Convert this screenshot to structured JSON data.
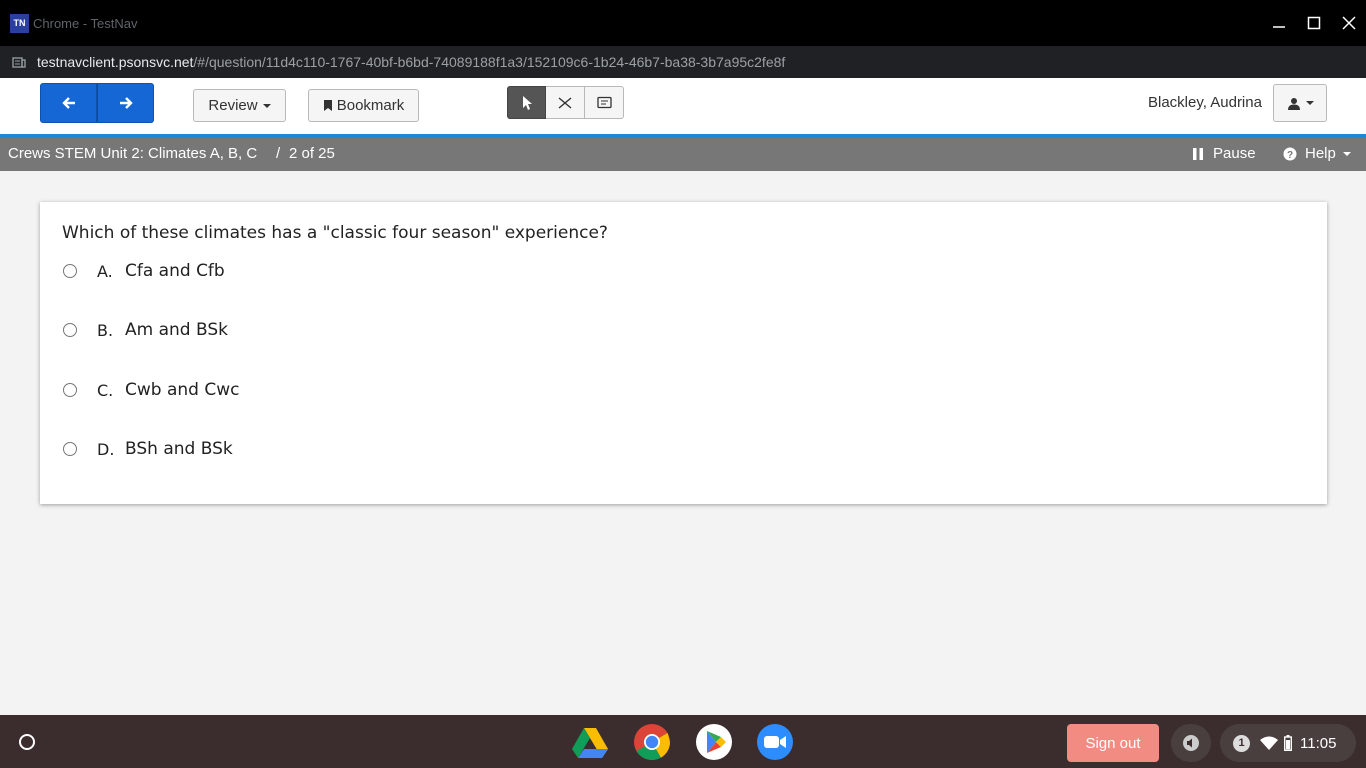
{
  "window": {
    "app_icon_text": "TN",
    "title": "Chrome - TestNav"
  },
  "url": {
    "host": "testnavclient.psonsvc.net",
    "path": "/#/question/11d4c110-1767-40bf-b6bd-74089188f1a3/152109c6-1b24-46b7-ba38-3b7a95c2fe8f"
  },
  "toolbar": {
    "review_label": "Review",
    "bookmark_label": "Bookmark",
    "user_name": "Blackley, Audrina"
  },
  "test_info": {
    "test_name": "Crews STEM Unit 2: Climates A, B, C",
    "separator": "/",
    "progress": "2 of 25",
    "pause_label": "Pause",
    "help_label": "Help"
  },
  "question": {
    "prompt": "Which of these climates has a \"classic four season\" experience?",
    "options": [
      {
        "letter": "A.",
        "text": "Cfa and Cfb"
      },
      {
        "letter": "B.",
        "text": "Am and BSk"
      },
      {
        "letter": "C.",
        "text": "Cwb and Cwc"
      },
      {
        "letter": "D.",
        "text": "BSh and BSk"
      }
    ]
  },
  "shelf": {
    "signout_label": "Sign out",
    "notification_count": "1",
    "time": "11:05",
    "apps": [
      "google-drive-icon",
      "chrome-icon",
      "play-store-icon",
      "zoom-icon"
    ]
  },
  "colors": {
    "nav_blue": "#1667d6",
    "info_bar": "#777777",
    "accent_strip": "#1a8ad6",
    "signout": "#f28b82"
  }
}
